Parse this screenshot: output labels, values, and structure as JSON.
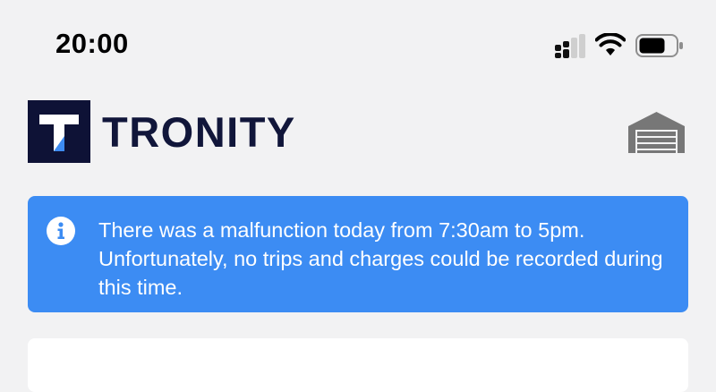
{
  "status_bar": {
    "time": "20:00",
    "icons": [
      "cellular-signal-icon",
      "wifi-icon",
      "battery-icon"
    ]
  },
  "header": {
    "logo_mark_letter": "T",
    "brand_name": "TRONITY",
    "garage_icon": "garage-icon"
  },
  "alert": {
    "icon": "info-icon",
    "message": "There was a malfunction today from 7:30am to 5pm. Unfortunately, no trips and charges could be recorded during this time."
  },
  "colors": {
    "background": "#f2f2f3",
    "brand_navy": "#0e1236",
    "brand_accent": "#3d8bf2",
    "alert_background": "#3c8cf3",
    "alert_text": "#ffffff",
    "icon_gray": "#7a7a7a"
  }
}
